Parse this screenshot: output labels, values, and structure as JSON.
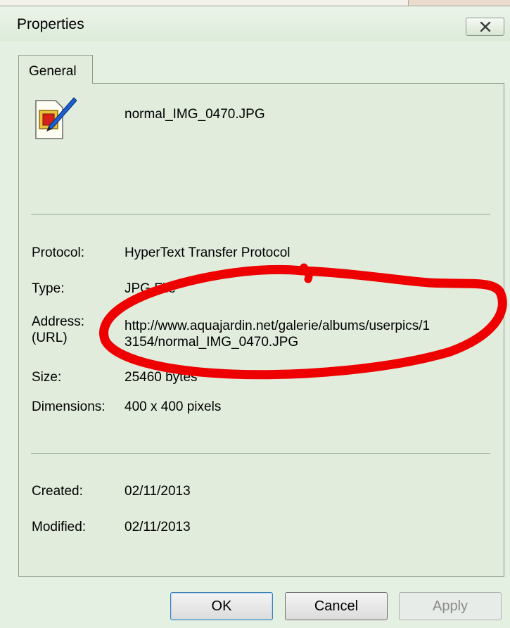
{
  "window": {
    "title": "Properties",
    "close_icon": "close-icon"
  },
  "tabs": [
    {
      "label": "General",
      "selected": true
    }
  ],
  "file": {
    "icon": "image-file-icon",
    "name": "normal_IMG_0470.JPG"
  },
  "details": {
    "protocol_label": "Protocol:",
    "protocol_value": "HyperText Transfer Protocol",
    "type_label": "Type:",
    "type_value": "JPG File",
    "address_label": "Address:\n(URL)",
    "address_value": "http://www.aquajardin.net/galerie/albums/userpics/1\n3154/normal_IMG_0470.JPG",
    "size_label": "Size:",
    "size_value": "25460 bytes",
    "dimensions_label": "Dimensions:",
    "dimensions_value": "400  x  400  pixels"
  },
  "dates": {
    "created_label": "Created:",
    "created_value": "02/11/2013",
    "modified_label": "Modified:",
    "modified_value": "02/11/2013"
  },
  "buttons": {
    "ok": "OK",
    "cancel": "Cancel",
    "apply": "Apply"
  },
  "annotation": {
    "shape": "hand-drawn circle around URL",
    "color": "#ee0000"
  }
}
